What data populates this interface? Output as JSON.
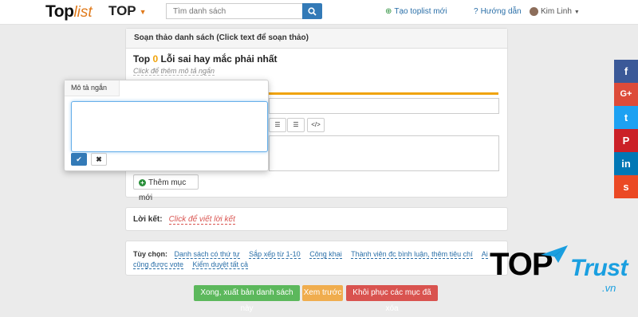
{
  "header": {
    "logo_top": "Top",
    "logo_list": "list",
    "menu_label": "TOP",
    "search_placeholder": "Tìm danh sách",
    "create_link": "Tạo toplist mới",
    "help_link": "Hướng dẫn",
    "user_name": "Kim Linh"
  },
  "editor": {
    "panel_title": "Soạn thảo danh sách (Click text để soạn thảo)",
    "title_prefix": "Top",
    "title_count": "0",
    "title_text": "Lỗi sai hay mắc phải nhất",
    "desc_hint": "Click để thêm mô tả ngắn",
    "add_item_label": "Thêm mục mới"
  },
  "popover": {
    "title": "Mô tả ngắn",
    "textarea_value": "",
    "ok_symbol": "✔",
    "cancel_symbol": "✖"
  },
  "epilogue": {
    "label": "Lời kết:",
    "hint": "Click để viết lời kết"
  },
  "options": {
    "label": "Tùy chọn:",
    "items": [
      "Danh sách có thứ tự",
      "Sắp xếp từ 1-10",
      "Công khai",
      "Thành viên đc bình luận, thêm tiêu chí",
      "Ai cũng được vote",
      "Kiểm duyệt tất cả"
    ]
  },
  "actions": {
    "publish": "Xong, xuất bản danh sách này",
    "preview": "Xem trước",
    "restore": "Khôi phục các mục đã xóa"
  },
  "social": {
    "facebook": "f",
    "google": "G+",
    "twitter": "t",
    "pinterest": "P",
    "linkedin": "in",
    "stumbleupon": "s"
  },
  "watermark": {
    "top": "TOP",
    "trust": "Trust",
    "vn": ".vn"
  },
  "colors": {
    "primary": "#337ab7",
    "accent": "#f0a30a",
    "success": "#5cb85c",
    "warning": "#f0ad4e",
    "danger": "#d9534f",
    "facebook": "#3b5998",
    "google": "#dd4b39",
    "twitter": "#1da1f2",
    "pinterest": "#cb2027",
    "linkedin": "#0077b5",
    "stumbleupon": "#eb4924"
  }
}
